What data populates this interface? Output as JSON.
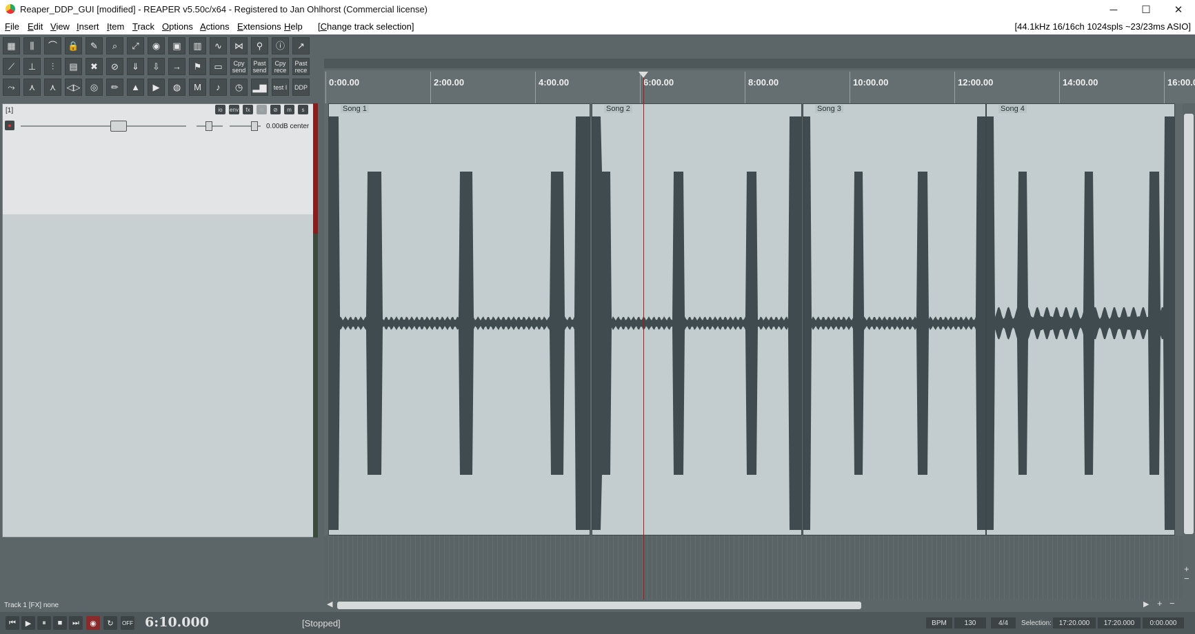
{
  "window": {
    "title": "Reaper_DDP_GUI [modified] - REAPER v5.50c/x64 - Registered to Jan Ohlhorst (Commercial license)",
    "minimize": "─",
    "maximize": "☐",
    "close": "✕"
  },
  "menu": {
    "items": [
      "File",
      "Edit",
      "View",
      "Insert",
      "Item",
      "Track",
      "Options",
      "Actions",
      "Extensions",
      "Help",
      "[Change track selection]"
    ],
    "audio_status": "[44.1kHz 16/16ch 1024spls ~23/23ms ASIO]"
  },
  "toolbar": {
    "row3_labels": {
      "copy_send": "Cpy send",
      "paste_send": "Past send",
      "copy_rec": "Cpy rece",
      "paste_rec": "Past rece",
      "test": "test I",
      "ddp": "DDP"
    }
  },
  "track": {
    "number": "[1]",
    "volume_pan": "0.00dB center",
    "buttons": [
      "io",
      "env",
      "fx",
      "m",
      "s"
    ],
    "status_line": "Track 1 [FX] none"
  },
  "ruler": {
    "ticks": [
      "0:00.00",
      "2:00.00",
      "4:00.00",
      "6:00.00",
      "8:00.00",
      "10:00.00",
      "12:00.00",
      "14:00.00",
      "16:00.00"
    ]
  },
  "items": [
    {
      "label": "Song 1"
    },
    {
      "label": "Song 2"
    },
    {
      "label": "Song 3"
    },
    {
      "label": "Song 4"
    }
  ],
  "transport": {
    "time": "6:10.000",
    "state": "[Stopped]",
    "off_label": "OFF",
    "bpm_label": "BPM",
    "bpm": "130",
    "timesig": "4/4",
    "selection_label": "Selection:",
    "sel_start": "17:20.000",
    "sel_end": "17:20.000",
    "sel_len": "0:00.000"
  },
  "colors": {
    "waveform": "#3f4b4f",
    "item_bg": "#c3cdcf",
    "cursor": "#b01818"
  }
}
